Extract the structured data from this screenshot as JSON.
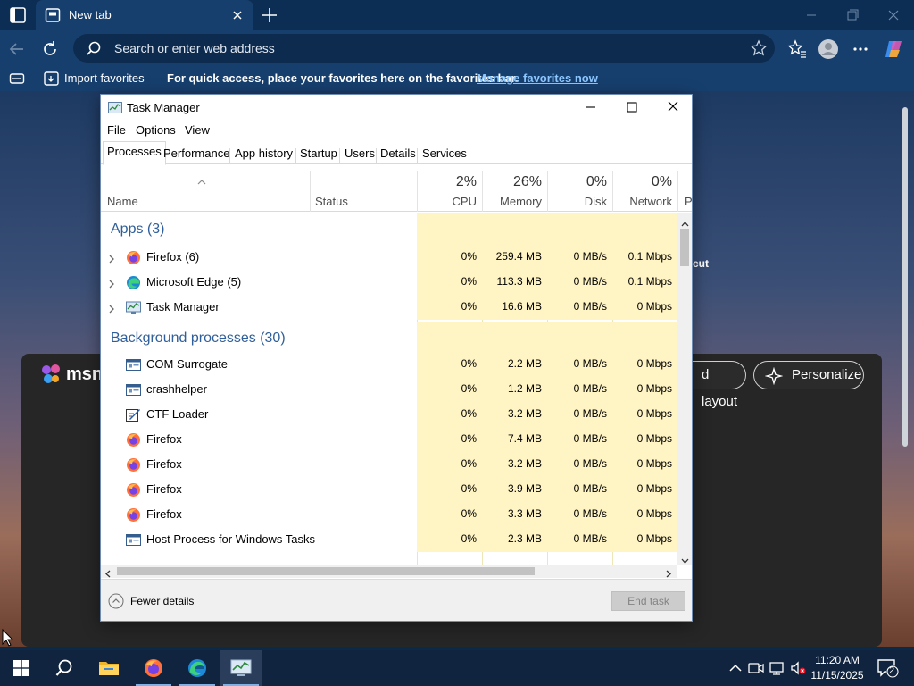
{
  "browser": {
    "tab_title": "New tab",
    "address_placeholder": "Search or enter web address",
    "favorites_bar": {
      "import_label": "Import favorites",
      "message": "For quick access, place your favorites here on the favorites bar.",
      "manage_link": "Manage favorites now"
    }
  },
  "newtab": {
    "msn_label": "msn",
    "layout_button": "d layout",
    "personalize_button": "Personalize",
    "shortcut_fragment": "cut"
  },
  "task_manager": {
    "title": "Task Manager",
    "menu": [
      "File",
      "Options",
      "View"
    ],
    "tabs": [
      "Processes",
      "Performance",
      "App history",
      "Startup",
      "Users",
      "Details",
      "Services"
    ],
    "active_tab": "Processes",
    "columns": {
      "name": "Name",
      "status": "Status",
      "cpu": {
        "pct": "2%",
        "label": "CPU"
      },
      "memory": {
        "pct": "26%",
        "label": "Memory"
      },
      "disk": {
        "pct": "0%",
        "label": "Disk"
      },
      "network": {
        "pct": "0%",
        "label": "Network"
      },
      "partial": "P"
    },
    "groups": {
      "apps": "Apps (3)",
      "background": "Background processes (30)"
    },
    "apps": [
      {
        "name": "Firefox (6)",
        "icon": "firefox-icon",
        "cpu": "0%",
        "memory": "259.4 MB",
        "disk": "0 MB/s",
        "network": "0.1 Mbps"
      },
      {
        "name": "Microsoft Edge (5)",
        "icon": "edge-icon",
        "cpu": "0%",
        "memory": "113.3 MB",
        "disk": "0 MB/s",
        "network": "0.1 Mbps"
      },
      {
        "name": "Task Manager",
        "icon": "task-manager-icon",
        "cpu": "0%",
        "memory": "16.6 MB",
        "disk": "0 MB/s",
        "network": "0 Mbps"
      }
    ],
    "background": [
      {
        "name": "COM Surrogate",
        "icon": "window-app-icon",
        "cpu": "0%",
        "memory": "2.2 MB",
        "disk": "0 MB/s",
        "network": "0 Mbps"
      },
      {
        "name": "crashhelper",
        "icon": "window-app-icon",
        "cpu": "0%",
        "memory": "1.2 MB",
        "disk": "0 MB/s",
        "network": "0 Mbps"
      },
      {
        "name": "CTF Loader",
        "icon": "ctf-loader-icon",
        "cpu": "0%",
        "memory": "3.2 MB",
        "disk": "0 MB/s",
        "network": "0 Mbps"
      },
      {
        "name": "Firefox",
        "icon": "firefox-icon",
        "cpu": "0%",
        "memory": "7.4 MB",
        "disk": "0 MB/s",
        "network": "0 Mbps"
      },
      {
        "name": "Firefox",
        "icon": "firefox-icon",
        "cpu": "0%",
        "memory": "3.2 MB",
        "disk": "0 MB/s",
        "network": "0 Mbps"
      },
      {
        "name": "Firefox",
        "icon": "firefox-icon",
        "cpu": "0%",
        "memory": "3.9 MB",
        "disk": "0 MB/s",
        "network": "0 Mbps"
      },
      {
        "name": "Firefox",
        "icon": "firefox-icon",
        "cpu": "0%",
        "memory": "3.3 MB",
        "disk": "0 MB/s",
        "network": "0 Mbps"
      },
      {
        "name": "Host Process for Windows Tasks",
        "icon": "window-app-icon",
        "cpu": "0%",
        "memory": "2.3 MB",
        "disk": "0 MB/s",
        "network": "0 Mbps"
      }
    ],
    "fewer_details": "Fewer details",
    "end_task": "End task"
  },
  "taskbar": {
    "time": "11:20 AM",
    "date": "11/15/2025",
    "notification_count": "2"
  },
  "colors": {
    "usage_highlight": "#fff4c4",
    "group_header": "#2f5f9a",
    "browser_frame": "#0c2e55",
    "toolbar": "#173f6e",
    "link": "#8cc6ff"
  }
}
